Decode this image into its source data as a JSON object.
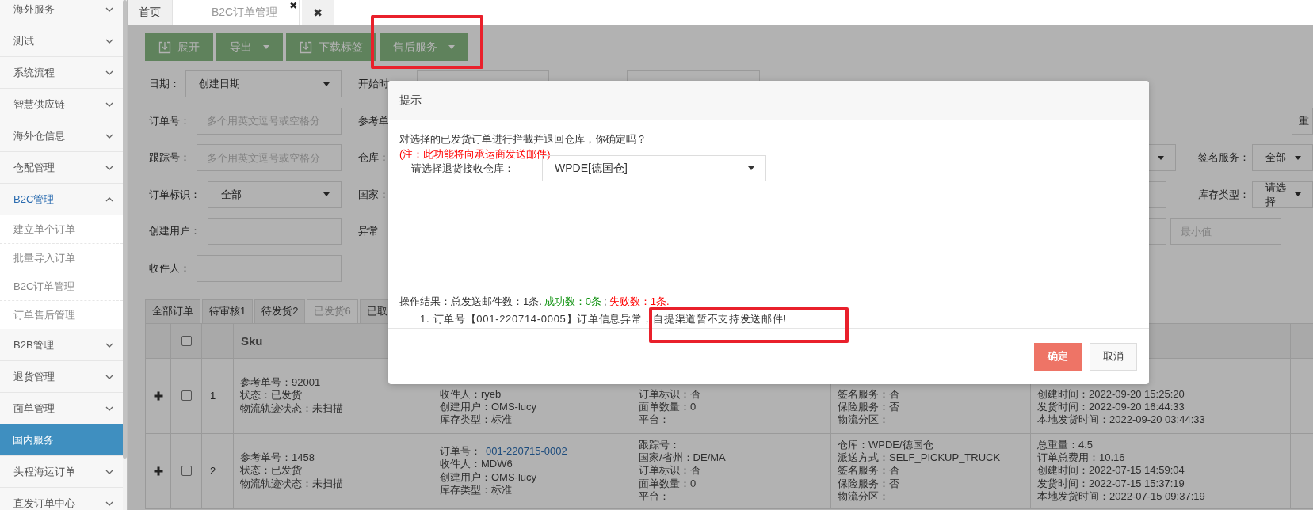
{
  "sidebar": {
    "items": [
      {
        "label": "海外服务",
        "kind": "group",
        "expanded": false,
        "selected": false
      },
      {
        "label": "测试",
        "kind": "group",
        "expanded": false,
        "selected": false
      },
      {
        "label": "系统流程",
        "kind": "group",
        "expanded": false,
        "selected": false
      },
      {
        "label": "智慧供应链",
        "kind": "group",
        "expanded": false,
        "selected": false
      },
      {
        "label": "海外仓信息",
        "kind": "group",
        "expanded": false,
        "selected": false
      },
      {
        "label": "仓配管理",
        "kind": "group",
        "expanded": false,
        "selected": false
      },
      {
        "label": "B2C管理",
        "kind": "group",
        "expanded": true,
        "selected": false,
        "children": [
          {
            "label": "建立单个订单",
            "selected": false
          },
          {
            "label": "批量导入订单",
            "selected": false
          },
          {
            "label": "B2C订单管理",
            "selected": false
          },
          {
            "label": "订单售后管理",
            "selected": false
          }
        ]
      },
      {
        "label": "B2B管理",
        "kind": "group",
        "expanded": false,
        "selected": false
      },
      {
        "label": "退货管理",
        "kind": "group",
        "expanded": false,
        "selected": false
      },
      {
        "label": "面单管理",
        "kind": "group",
        "expanded": false,
        "selected": false
      },
      {
        "label": "国内服务",
        "kind": "page",
        "expanded": false,
        "selected": true
      },
      {
        "label": "头程海运订单",
        "kind": "group",
        "expanded": false,
        "selected": false
      },
      {
        "label": "直发订单中心",
        "kind": "group",
        "expanded": false,
        "selected": false
      }
    ]
  },
  "tabs": [
    {
      "label": "首页",
      "selected": false
    },
    {
      "label": "B2C订单管理",
      "selected": true,
      "close": "✖"
    },
    {
      "label": "✖",
      "selected": false
    }
  ],
  "toolbar": [
    {
      "text": "展开",
      "kind": "download"
    },
    {
      "text": "导出",
      "kind": "dropdown"
    },
    {
      "text": "下载标签",
      "kind": "download"
    },
    {
      "text": "售后服务",
      "kind": "dropdown"
    }
  ],
  "filters": [
    [
      {
        "kind": "label",
        "text": "日期："
      },
      {
        "kind": "select",
        "value": "创建日期"
      },
      {
        "kind": "label",
        "text": "开始时"
      },
      {
        "kind": "input"
      },
      {
        "kind": "input"
      }
    ],
    [
      {
        "kind": "label",
        "text": "订单号："
      },
      {
        "kind": "input",
        "placeholder": "多个用英文逗号或空格分"
      },
      {
        "kind": "label",
        "text": "参考单"
      },
      {
        "kind": "button",
        "text": "重"
      }
    ],
    [
      {
        "kind": "label",
        "text": "跟踪号："
      },
      {
        "kind": "input",
        "placeholder": "多个用英文逗号或空格分"
      },
      {
        "kind": "label",
        "text": "仓库："
      },
      {
        "kind": "select"
      },
      {
        "kind": "label",
        "text": "签名服务："
      },
      {
        "kind": "select",
        "value": "全部"
      }
    ],
    [
      {
        "kind": "label",
        "text": "订单标识："
      },
      {
        "kind": "select",
        "value": "全部"
      },
      {
        "kind": "label",
        "text": "国家："
      },
      {
        "kind": "input"
      },
      {
        "kind": "label",
        "text": "库存类型："
      },
      {
        "kind": "select",
        "value": "请选择"
      }
    ],
    [
      {
        "kind": "label",
        "text": "创建用户："
      },
      {
        "kind": "input"
      },
      {
        "kind": "label",
        "text": "异常"
      },
      {
        "kind": "input"
      },
      {
        "kind": "input",
        "placeholder": "最小值"
      }
    ],
    [
      {
        "kind": "label",
        "text": "收件人："
      },
      {
        "kind": "input"
      }
    ]
  ],
  "status_tabs": [
    {
      "label": "全部订单",
      "selected": false
    },
    {
      "label": "待审核1",
      "selected": false
    },
    {
      "label": "待发货2",
      "selected": false
    },
    {
      "label": "已发货6",
      "selected": true
    },
    {
      "label": "已取",
      "selected": false
    }
  ],
  "table": {
    "header_checked": false,
    "sku_header": "Sku",
    "rows": [
      {
        "checked": false,
        "index": "1",
        "cells": [
          [
            "参考单号：92001",
            "状态：已发货",
            "物流轨迹状态：未扫描"
          ],
          [
            "收件人：ryeb",
            "创建用户：OMS-lucy",
            "库存类型：标准"
          ],
          [
            "订单标识：否",
            "面单数量：0",
            "平台："
          ],
          [
            "签名服务：否",
            "保险服务：否",
            "物流分区："
          ],
          [
            "创建时间：2022-09-20 15:25:20",
            "发货时间：2022-09-20 16:44:33",
            "本地发货时间：2022-09-20 03:44:33"
          ]
        ]
      },
      {
        "checked": false,
        "index": "2",
        "cells": [
          [
            "参考单号：1458",
            "状态：已发货",
            "物流轨迹状态：未扫描"
          ],
          [
            {
              "text": "订单号：",
              "link": "001-220715-0002"
            },
            "收件人：MDW6",
            "创建用户：OMS-lucy",
            "库存类型：标准"
          ],
          [
            "跟踪号：",
            "国家/省州：DE/MA",
            "订单标识：否",
            "面单数量：0",
            "平台："
          ],
          [
            "仓库：WPDE/德国仓",
            "派送方式：SELF_PICKUP_TRUCK",
            "签名服务：否",
            "保险服务：否",
            "物流分区："
          ],
          [
            "总重量：4.5",
            "订单总费用：10.16",
            "创建时间：2022-07-15 14:59:04",
            "发货时间：2022-07-15 15:37:19",
            "本地发货时间：2022-07-15 09:37:19"
          ]
        ]
      }
    ]
  },
  "dialog": {
    "title": "提示",
    "message": "对选择的已发货订单进行拦截并退回仓库，你确定吗？",
    "note": "(注：此功能将向承运商发送邮件)",
    "warehouse_label": "请选择退货接收仓库：",
    "warehouse_value": "WPDE[德国仓]",
    "result": [
      {
        "text": "操作结果：总发送邮件数：1条.",
        "kind": "normal"
      },
      {
        "text": "成功数：0条",
        "kind": "success"
      },
      {
        "text": ";",
        "kind": "normal"
      },
      {
        "text": "失败数：1条.",
        "kind": "error"
      }
    ],
    "detail": "1. 订单号【001-220714-0005】订单信息异常，自提渠道暂不支持发送邮件!",
    "buttons": [
      {
        "text": "确定",
        "kind": "primary"
      },
      {
        "text": "取消",
        "kind": "default"
      }
    ]
  }
}
